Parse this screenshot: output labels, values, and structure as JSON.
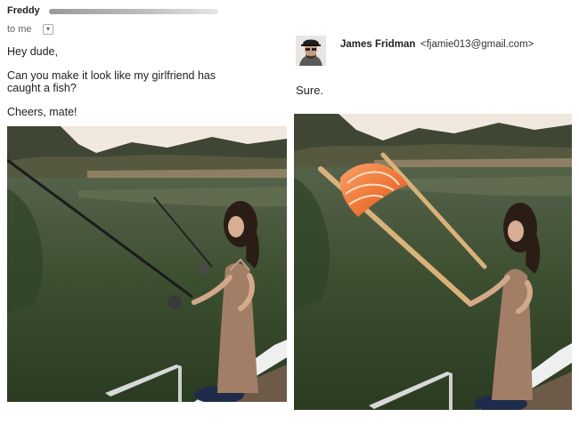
{
  "email": {
    "sender_name": "Freddy",
    "recipient_line": "to me",
    "message_lines": [
      "Hey dude,",
      "Can you make it look like my girlfriend has caught a fish?",
      "Cheers, mate!"
    ]
  },
  "reply": {
    "sender_name": "James Fridman",
    "sender_email": "<fjamie013@gmail.com>",
    "text": "Sure."
  },
  "icons": {
    "recipient_dropdown": "chevron-down-icon",
    "avatar": "user-avatar-icon"
  },
  "colors": {
    "water": "#3c4f30",
    "dress": "#a37e66",
    "salmon": "#f07a3a",
    "chopstick": "#d9b27a",
    "sky": "#f3ece3"
  }
}
